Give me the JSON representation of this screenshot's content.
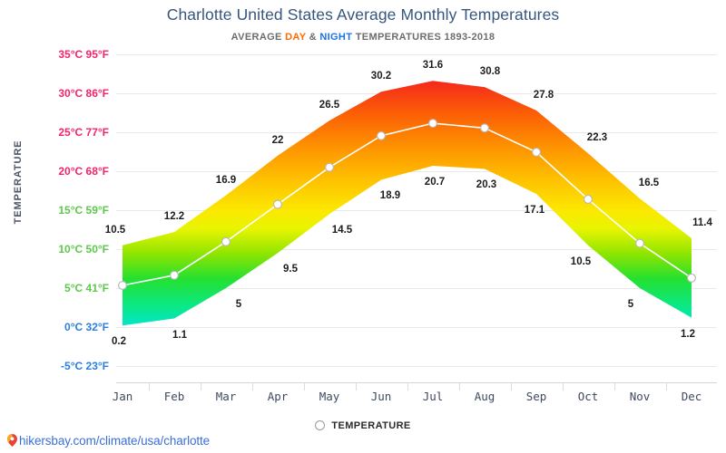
{
  "header": {
    "title": "Charlotte United States Average Monthly Temperatures",
    "subtitle_prefix": "AVERAGE ",
    "subtitle_day": "DAY",
    "subtitle_amp": " & ",
    "subtitle_night": "NIGHT",
    "subtitle_suffix": " TEMPERATURES 1893-2018",
    "day_color": "#ff6a00",
    "night_color": "#1a73e8",
    "title_color": "#36567d"
  },
  "axes": {
    "y_title": "TEMPERATURE",
    "y_ticks": [
      {
        "label": "35°C 95°F",
        "value": 35,
        "color": "#f5256b"
      },
      {
        "label": "30°C 86°F",
        "value": 30,
        "color": "#f5256b"
      },
      {
        "label": "25°C 77°F",
        "value": 25,
        "color": "#f5256b"
      },
      {
        "label": "20°C 68°F",
        "value": 20,
        "color": "#f5256b"
      },
      {
        "label": "15°C 59°F",
        "value": 15,
        "color": "#5dc94a"
      },
      {
        "label": "10°C 50°F",
        "value": 10,
        "color": "#5dc94a"
      },
      {
        "label": "5°C 41°F",
        "value": 5,
        "color": "#5dc94a"
      },
      {
        "label": "0°C 32°F",
        "value": 0,
        "color": "#2b7fe0"
      },
      {
        "label": "-5°C 23°F",
        "value": -5,
        "color": "#2b7fe0"
      }
    ]
  },
  "legend": {
    "items": [
      {
        "label": "TEMPERATURE",
        "marker": "circle-outline"
      }
    ]
  },
  "footer": {
    "url": "hikersbay.com/climate/usa/charlotte",
    "icon": "location-pin-icon",
    "url_color": "#3a6fd8"
  },
  "chart_data": {
    "type": "area",
    "title": "Charlotte United States Average Monthly Temperatures",
    "subtitle": "AVERAGE DAY & NIGHT TEMPERATURES 1893-2018",
    "xlabel": "",
    "ylabel": "TEMPERATURE",
    "ylim": [
      -5,
      35
    ],
    "ytick_step": 5,
    "grid": true,
    "legend_position": "bottom",
    "categories": [
      "Jan",
      "Feb",
      "Mar",
      "Apr",
      "May",
      "Jun",
      "Jul",
      "Aug",
      "Sep",
      "Oct",
      "Nov",
      "Dec"
    ],
    "series": [
      {
        "name": "DAY",
        "label_position": "above",
        "values": [
          10.5,
          12.2,
          16.9,
          22,
          26.5,
          30.2,
          31.6,
          30.8,
          27.8,
          22.3,
          16.5,
          11.4
        ]
      },
      {
        "name": "NIGHT",
        "label_position": "below",
        "values": [
          0.2,
          1.1,
          5,
          9.5,
          14.5,
          18.9,
          20.7,
          20.3,
          17.1,
          10.5,
          5,
          1.2
        ]
      },
      {
        "name": "TEMPERATURE",
        "label_position": "none",
        "marker": "circle-outline",
        "values": [
          5.35,
          6.65,
          10.95,
          15.75,
          20.5,
          24.55,
          26.15,
          25.55,
          22.45,
          16.4,
          10.75,
          6.3
        ]
      }
    ]
  }
}
